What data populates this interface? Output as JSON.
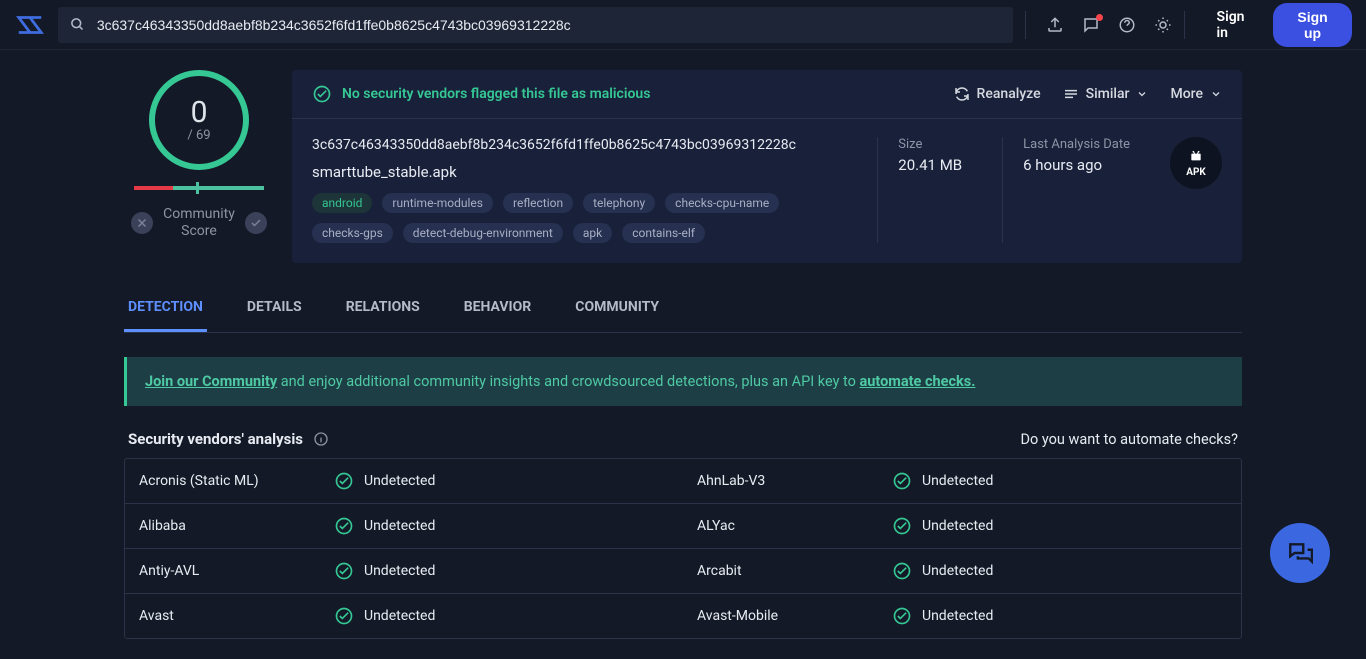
{
  "header": {
    "search_value": "3c637c46343350dd8aebf8b234c3652f6fd1ffe0b8625c4743bc03969312228c",
    "signin": "Sign in",
    "signup": "Sign up"
  },
  "score": {
    "count": "0",
    "total": "/ 69",
    "community_label": "Community\nScore"
  },
  "info": {
    "safe_msg": "No security vendors flagged this file as malicious",
    "reanalyze": "Reanalyze",
    "similar": "Similar",
    "more": "More",
    "hash": "3c637c46343350dd8aebf8b234c3652f6fd1ffe0b8625c4743bc03969312228c",
    "filename": "smarttube_stable.apk",
    "tags": [
      "android",
      "runtime-modules",
      "reflection",
      "telephony",
      "checks-cpu-name",
      "checks-gps",
      "detect-debug-environment",
      "apk",
      "contains-elf"
    ],
    "size_label": "Size",
    "size_val": "20.41 MB",
    "date_label": "Last Analysis Date",
    "date_val": "6 hours ago",
    "badge": "APK"
  },
  "tabs": [
    "DETECTION",
    "DETAILS",
    "RELATIONS",
    "BEHAVIOR",
    "COMMUNITY"
  ],
  "banner": {
    "link1": "Join our Community",
    "mid": " and enjoy additional community insights and crowdsourced detections, plus an API key to ",
    "link2": "automate checks."
  },
  "table": {
    "title": "Security vendors' analysis",
    "automate": "Do you want to automate checks?",
    "status": "Undetected",
    "rows": [
      [
        "Acronis (Static ML)",
        "AhnLab-V3"
      ],
      [
        "Alibaba",
        "ALYac"
      ],
      [
        "Antiy-AVL",
        "Arcabit"
      ],
      [
        "Avast",
        "Avast-Mobile"
      ]
    ]
  }
}
